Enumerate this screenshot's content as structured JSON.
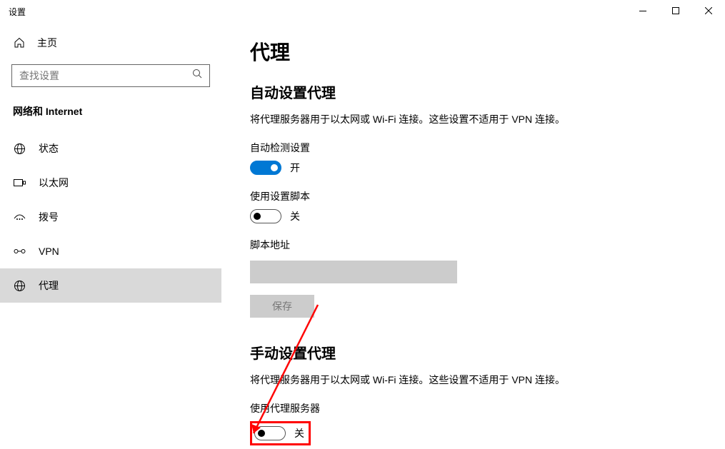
{
  "window": {
    "title": "设置"
  },
  "sidebar": {
    "home": "主页",
    "search_placeholder": "查找设置",
    "category": "网络和 Internet",
    "items": [
      {
        "label": "状态"
      },
      {
        "label": "以太网"
      },
      {
        "label": "拨号"
      },
      {
        "label": "VPN"
      },
      {
        "label": "代理"
      }
    ]
  },
  "main": {
    "title": "代理",
    "auto": {
      "heading": "自动设置代理",
      "desc": "将代理服务器用于以太网或 Wi-Fi 连接。这些设置不适用于 VPN 连接。",
      "detect_label": "自动检测设置",
      "detect_state": "开",
      "script_toggle_label": "使用设置脚本",
      "script_toggle_state": "关",
      "script_addr_label": "脚本地址",
      "script_addr_value": "",
      "save_button": "保存"
    },
    "manual": {
      "heading": "手动设置代理",
      "desc": "将代理服务器用于以太网或 Wi-Fi 连接。这些设置不适用于 VPN 连接。",
      "use_proxy_label": "使用代理服务器",
      "use_proxy_state": "关"
    }
  }
}
